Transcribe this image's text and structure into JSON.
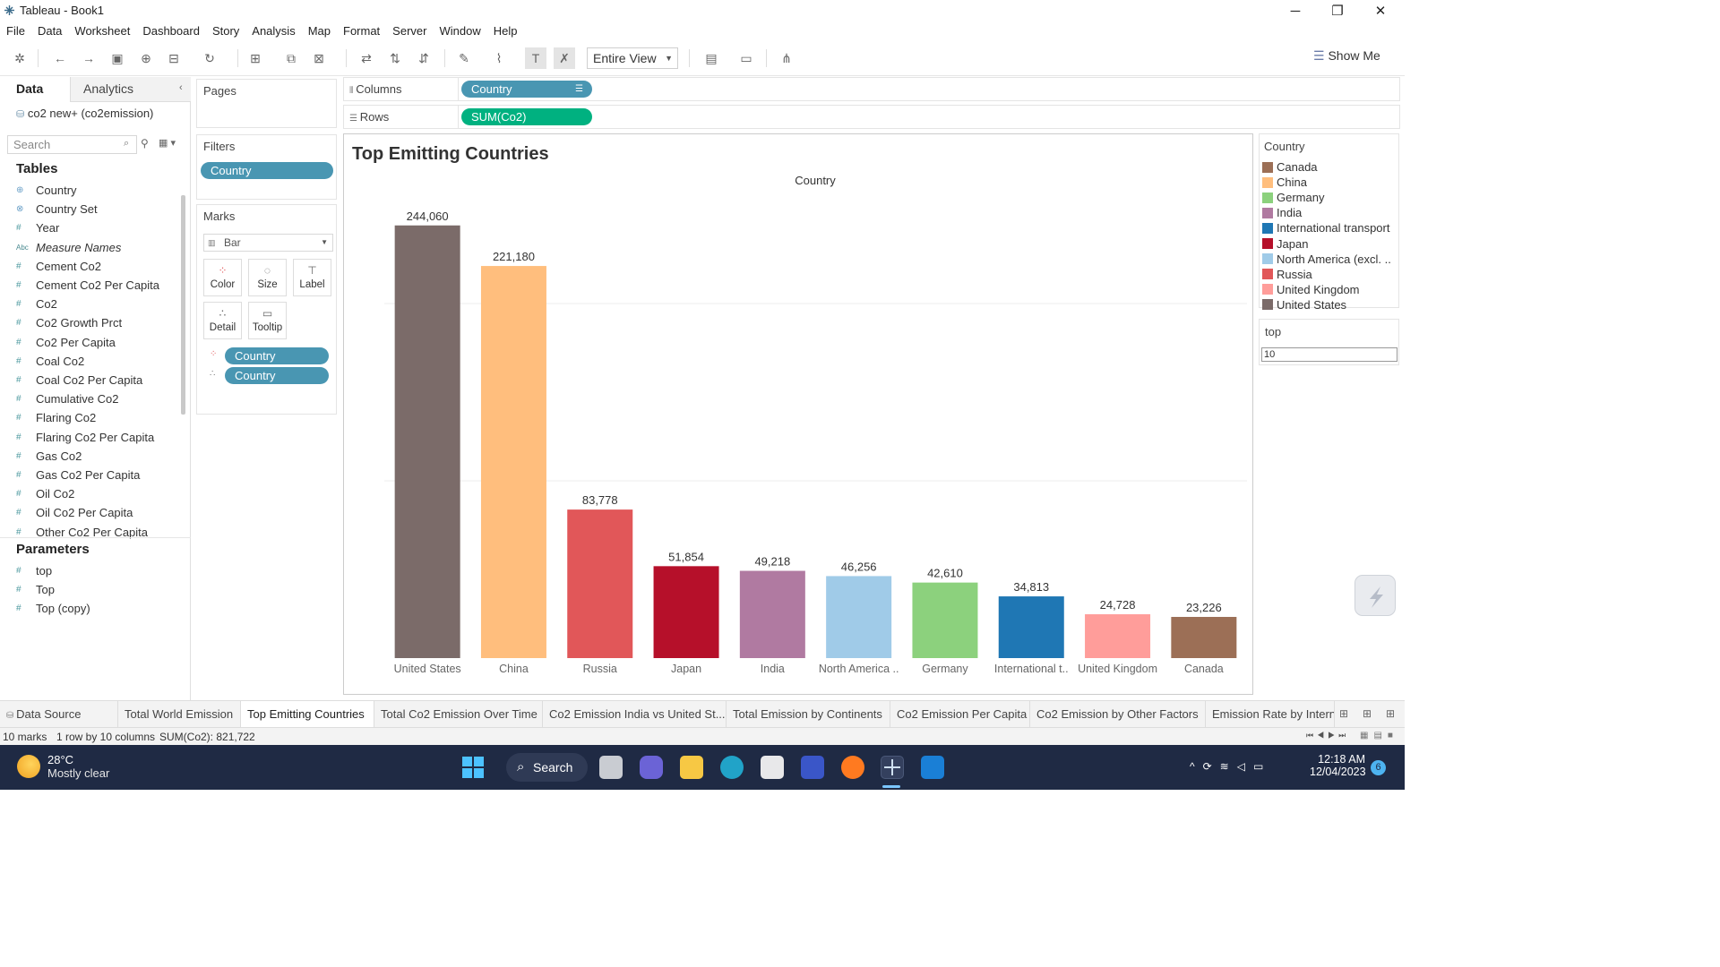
{
  "window": {
    "title": "Tableau - Book1",
    "minimize": "─",
    "restore": "❐",
    "close": "✕"
  },
  "menu": [
    "File",
    "Data",
    "Worksheet",
    "Dashboard",
    "Story",
    "Analysis",
    "Map",
    "Format",
    "Server",
    "Window",
    "Help"
  ],
  "toolbar": {
    "fit_label": "Entire View",
    "show_me": "Show Me"
  },
  "left": {
    "data_tab": "Data",
    "analytics_tab": "Analytics",
    "datasource": "co2 new+ (co2emission)",
    "search_placeholder": "Search",
    "tables_header": "Tables",
    "fields": [
      {
        "icon": "globe",
        "name": "Country"
      },
      {
        "icon": "set",
        "name": "Country Set"
      },
      {
        "icon": "hash",
        "name": "Year"
      },
      {
        "icon": "abc",
        "name": "Measure Names",
        "italic": true
      },
      {
        "icon": "hash",
        "name": "Cement Co2"
      },
      {
        "icon": "hash",
        "name": "Cement Co2 Per Capita"
      },
      {
        "icon": "hash",
        "name": "Co2"
      },
      {
        "icon": "hash",
        "name": "Co2 Growth Prct"
      },
      {
        "icon": "hash",
        "name": "Co2 Per Capita"
      },
      {
        "icon": "hash",
        "name": "Coal Co2"
      },
      {
        "icon": "hash",
        "name": "Coal Co2 Per Capita"
      },
      {
        "icon": "hash",
        "name": "Cumulative Co2"
      },
      {
        "icon": "hash",
        "name": "Flaring Co2"
      },
      {
        "icon": "hash",
        "name": "Flaring Co2 Per Capita"
      },
      {
        "icon": "hash",
        "name": "Gas Co2"
      },
      {
        "icon": "hash",
        "name": "Gas Co2 Per Capita"
      },
      {
        "icon": "hash",
        "name": "Oil Co2"
      },
      {
        "icon": "hash",
        "name": "Oil Co2 Per Capita"
      },
      {
        "icon": "hash",
        "name": "Other Co2 Per Capita"
      }
    ],
    "parameters_header": "Parameters",
    "parameters": [
      "top",
      "Top",
      "Top (copy)"
    ]
  },
  "cards": {
    "pages": "Pages",
    "filters": "Filters",
    "filter_pill": "Country",
    "marks": "Marks",
    "mark_type": "Bar",
    "mark_buttons": [
      "Color",
      "Size",
      "Label",
      "Detail",
      "Tooltip"
    ],
    "mark_pills": [
      "Country",
      "Country"
    ]
  },
  "shelves": {
    "columns_label": "Columns",
    "columns_pill": "Country",
    "rows_label": "Rows",
    "rows_pill": "SUM(Co2)"
  },
  "viz": {
    "title": "Top Emitting Countries",
    "header": "Country"
  },
  "chart_data": {
    "type": "bar",
    "title": "Top Emitting Countries",
    "xlabel": "Country",
    "ylabel": "",
    "categories": [
      "United States",
      "China",
      "Russia",
      "Japan",
      "India",
      "North America ..",
      "Germany",
      "International t..",
      "United Kingdom",
      "Canada"
    ],
    "values": [
      244060,
      221180,
      83778,
      51854,
      49218,
      46256,
      42610,
      34813,
      24728,
      23226
    ],
    "value_labels": [
      "244,060",
      "221,180",
      "83,778",
      "51,854",
      "49,218",
      "46,256",
      "42,610",
      "34,813",
      "24,728",
      "23,226"
    ],
    "colors": [
      "#7b6b69",
      "#ffbe7d",
      "#e15759",
      "#b6102a",
      "#b07aa1",
      "#a0cbe8",
      "#8cd17d",
      "#1f77b4",
      "#ff9d9a",
      "#9c6f56"
    ],
    "ylim": [
      0,
      250000
    ],
    "gridlines": [
      100000,
      200000
    ]
  },
  "legend": {
    "title": "Country",
    "items": [
      {
        "label": "Canada",
        "color": "#9c6f56"
      },
      {
        "label": "China",
        "color": "#ffbe7d"
      },
      {
        "label": "Germany",
        "color": "#8cd17d"
      },
      {
        "label": "India",
        "color": "#b07aa1"
      },
      {
        "label": "International transport",
        "color": "#1f77b4"
      },
      {
        "label": "Japan",
        "color": "#b6102a"
      },
      {
        "label": "North America (excl. ..",
        "color": "#a0cbe8"
      },
      {
        "label": "Russia",
        "color": "#e15759"
      },
      {
        "label": "United Kingdom",
        "color": "#ff9d9a"
      },
      {
        "label": "United States",
        "color": "#7b6b69"
      }
    ]
  },
  "param_card": {
    "title": "top",
    "value": "10"
  },
  "sheets": [
    "Data Source",
    "Total World Emission",
    "Top Emitting Countries",
    "Total Co2 Emission Over Time",
    "Co2 Emission India vs United St...",
    "Total Emission by Continents",
    "Co2 Emission Per Capita",
    "Co2 Emission  by Other Factors",
    "Emission Rate by Interna"
  ],
  "active_sheet": "Top Emitting Countries",
  "status": {
    "marks": "10 marks",
    "dims": "1 row by 10 columns",
    "sum": "SUM(Co2): 821,722"
  },
  "taskbar": {
    "temp": "28°C",
    "weather": "Mostly clear",
    "search": "Search",
    "time": "12:18 AM",
    "date": "12/04/2023",
    "notifications": "6"
  }
}
